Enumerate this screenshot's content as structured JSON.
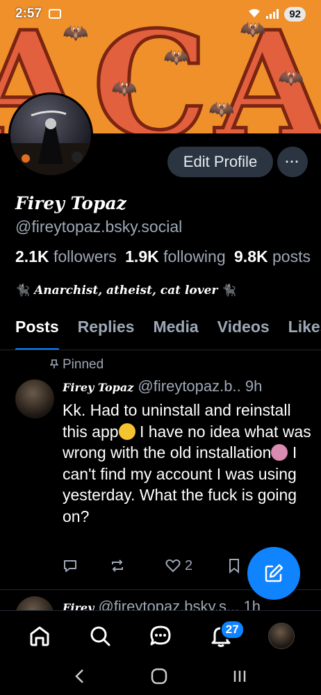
{
  "status_bar": {
    "time": "2:57",
    "battery": "92"
  },
  "profile": {
    "display_name": "Firey Topaz",
    "handle": "@fireytopaz.bsky.social",
    "followers_count": "2.1K",
    "followers_label": "followers",
    "following_count": "1.9K",
    "following_label": "following",
    "posts_count": "9.8K",
    "posts_label": "posts",
    "bio": "Anarchist, atheist, cat lover",
    "edit_profile_label": "Edit Profile",
    "more_label": "···",
    "banner_text": "ACAB"
  },
  "tabs": [
    {
      "label": "Posts",
      "active": true
    },
    {
      "label": "Replies"
    },
    {
      "label": "Media"
    },
    {
      "label": "Videos"
    },
    {
      "label": "Likes"
    }
  ],
  "pinned_post": {
    "pinned_label": "Pinned",
    "author": "Firey Topaz",
    "handle": "@fireytopaz.b..",
    "time": "9h",
    "text_1": "Kk. Had to uninstall and reinstall this app",
    "text_2": " I have no idea what was wrong with the old installation",
    "text_3": " I can't find my account I was using yesterday. What the fuck is going on?",
    "like_count": "2"
  },
  "next_post": {
    "author": "Firey",
    "handle": "@fireytopaz.bsky.s...",
    "time": "1h"
  },
  "bottom_nav": {
    "notification_badge": "27"
  },
  "colors": {
    "accent": "#1083fe",
    "muted": "#9ea8b6",
    "button_bg": "#2b3542",
    "banner": "#f0902a"
  }
}
